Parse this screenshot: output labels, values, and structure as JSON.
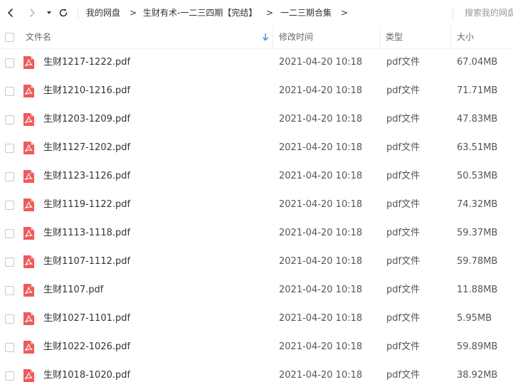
{
  "toolbar": {
    "breadcrumbs": [
      "我的网盘",
      "生财有术-一二三四期【完结】",
      "一二三期合集"
    ],
    "breadcrumb_separator": ">",
    "search_placeholder": "搜索我的网盘"
  },
  "columns": {
    "name": "文件名",
    "modified": "修改时间",
    "type": "类型",
    "size": "大小"
  },
  "sort": {
    "column": "文件名",
    "direction": "down"
  },
  "colors": {
    "pdf_icon": "#ef5a5a",
    "sort_arrow": "#4a90e2"
  },
  "files": [
    {
      "name": "生财1217-1222.pdf",
      "modified": "2021-04-20 10:18",
      "type": "pdf文件",
      "size": "67.04MB",
      "icon": "pdf-icon"
    },
    {
      "name": "生财1210-1216.pdf",
      "modified": "2021-04-20 10:18",
      "type": "pdf文件",
      "size": "71.71MB",
      "icon": "pdf-icon"
    },
    {
      "name": "生财1203-1209.pdf",
      "modified": "2021-04-20 10:18",
      "type": "pdf文件",
      "size": "47.83MB",
      "icon": "pdf-icon"
    },
    {
      "name": "生财1127-1202.pdf",
      "modified": "2021-04-20 10:18",
      "type": "pdf文件",
      "size": "63.51MB",
      "icon": "pdf-icon"
    },
    {
      "name": "生财1123-1126.pdf",
      "modified": "2021-04-20 10:18",
      "type": "pdf文件",
      "size": "50.53MB",
      "icon": "pdf-icon"
    },
    {
      "name": "生财1119-1122.pdf",
      "modified": "2021-04-20 10:18",
      "type": "pdf文件",
      "size": "74.32MB",
      "icon": "pdf-icon"
    },
    {
      "name": "生财1113-1118.pdf",
      "modified": "2021-04-20 10:18",
      "type": "pdf文件",
      "size": "59.37MB",
      "icon": "pdf-icon"
    },
    {
      "name": "生财1107-1112.pdf",
      "modified": "2021-04-20 10:18",
      "type": "pdf文件",
      "size": "59.78MB",
      "icon": "pdf-icon"
    },
    {
      "name": "生财1107.pdf",
      "modified": "2021-04-20 10:18",
      "type": "pdf文件",
      "size": "11.88MB",
      "icon": "pdf-icon"
    },
    {
      "name": "生财1027-1101.pdf",
      "modified": "2021-04-20 10:18",
      "type": "pdf文件",
      "size": "5.95MB",
      "icon": "pdf-icon"
    },
    {
      "name": "生财1022-1026.pdf",
      "modified": "2021-04-20 10:18",
      "type": "pdf文件",
      "size": "59.89MB",
      "icon": "pdf-icon"
    },
    {
      "name": "生财1018-1020.pdf",
      "modified": "2021-04-20 10:18",
      "type": "pdf文件",
      "size": "38.92MB",
      "icon": "pdf-icon"
    }
  ]
}
